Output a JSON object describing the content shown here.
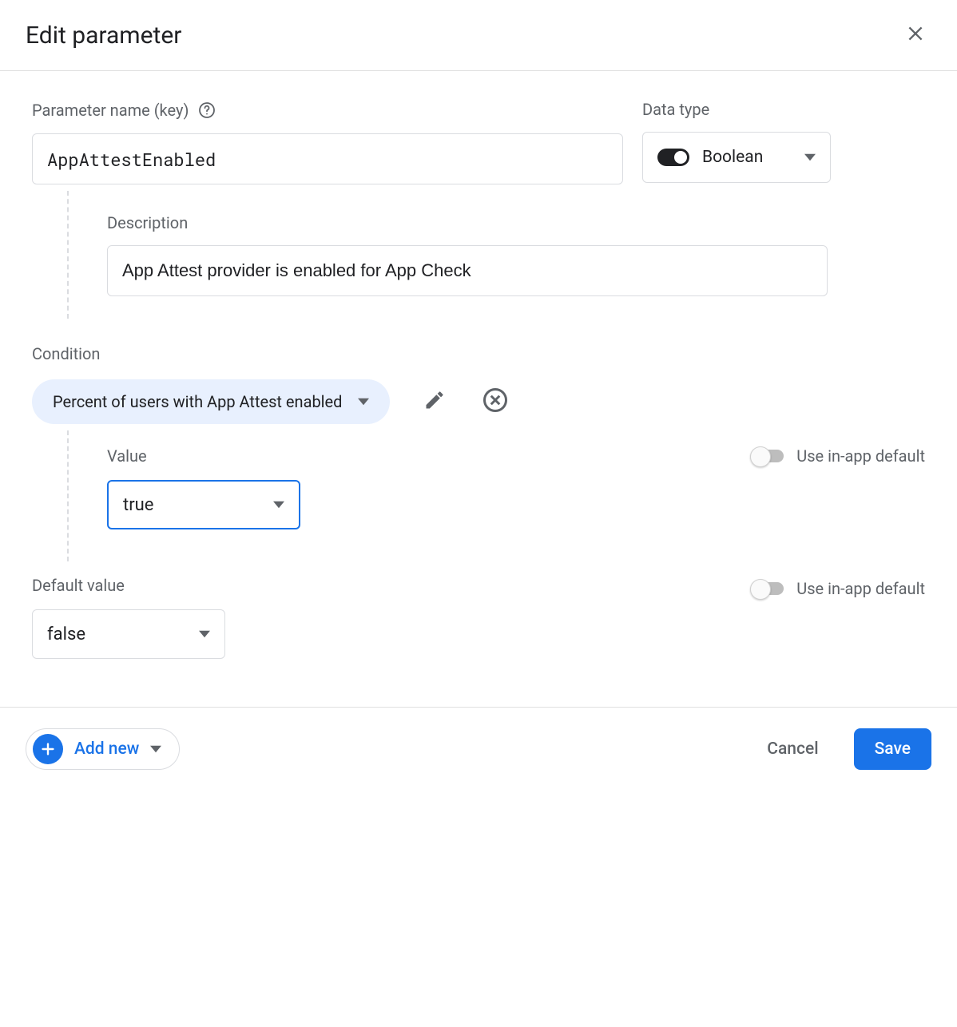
{
  "dialog": {
    "title": "Edit parameter"
  },
  "param_name": {
    "label": "Parameter name (key)",
    "value": "AppAttestEnabled"
  },
  "data_type": {
    "label": "Data type",
    "value": "Boolean"
  },
  "description": {
    "label": "Description",
    "value": "App Attest provider is enabled for App Check"
  },
  "condition": {
    "label": "Condition",
    "chip": "Percent of users with App Attest enabled",
    "value_label": "Value",
    "value": "true",
    "use_inapp_label": "Use in-app default"
  },
  "default_value": {
    "label": "Default value",
    "value": "false",
    "use_inapp_label": "Use in-app default"
  },
  "footer": {
    "add_new": "Add new",
    "cancel": "Cancel",
    "save": "Save"
  }
}
